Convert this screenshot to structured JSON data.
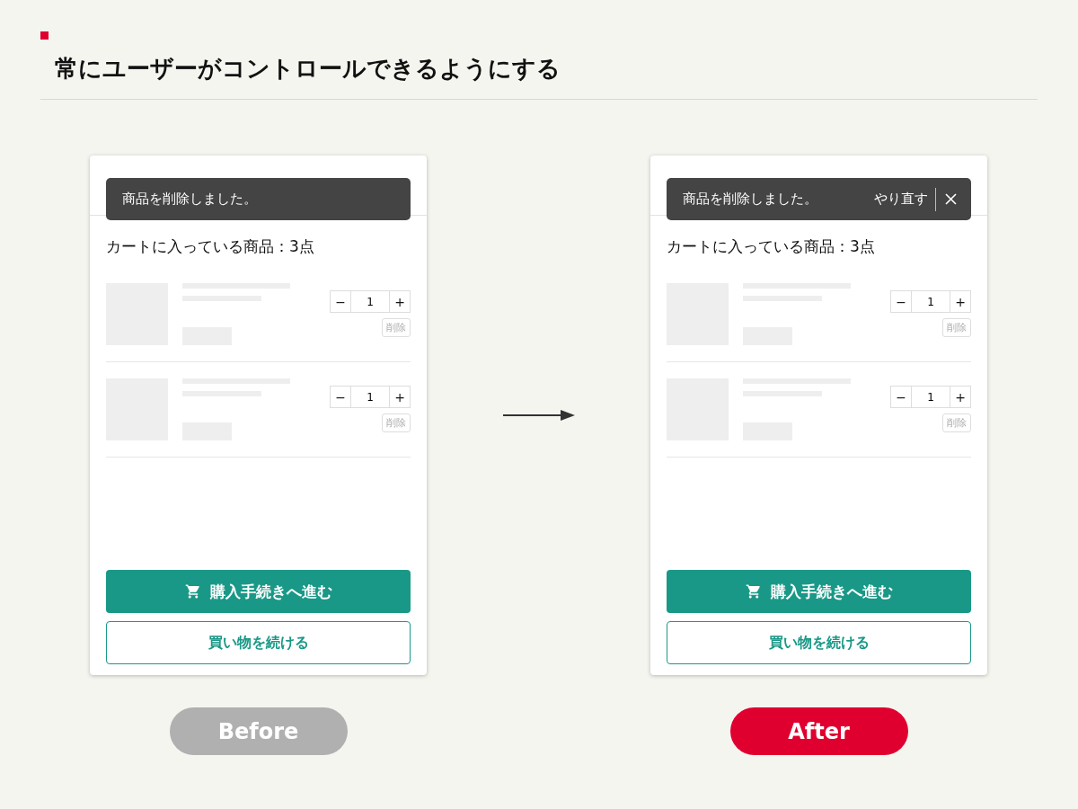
{
  "title": "常にユーザーがコントロールできるようにする",
  "panels": [
    {
      "label": "Before",
      "color": "#b0b0b0",
      "toast": {
        "message": "商品を削除しました。",
        "closable": false
      },
      "cart_title": "カートに入っている商品：3点",
      "items": [
        {
          "minus": "−",
          "quantity": "1",
          "plus": "+",
          "delete": "削除"
        },
        {
          "minus": "−",
          "quantity": "1",
          "plus": "+",
          "delete": "削除"
        }
      ],
      "checkout": "購入手続きへ進む",
      "continue": "買い物を続ける"
    },
    {
      "label": "After",
      "color": "#e0002f",
      "toast": {
        "message": "商品を削除しました。",
        "undo": "やり直す",
        "closable": true
      },
      "cart_title": "カートに入っている商品：3点",
      "items": [
        {
          "minus": "−",
          "quantity": "1",
          "plus": "+",
          "delete": "削除"
        },
        {
          "minus": "−",
          "quantity": "1",
          "plus": "+",
          "delete": "削除"
        }
      ],
      "checkout": "購入手続きへ進む",
      "continue": "買い物を続ける"
    }
  ]
}
